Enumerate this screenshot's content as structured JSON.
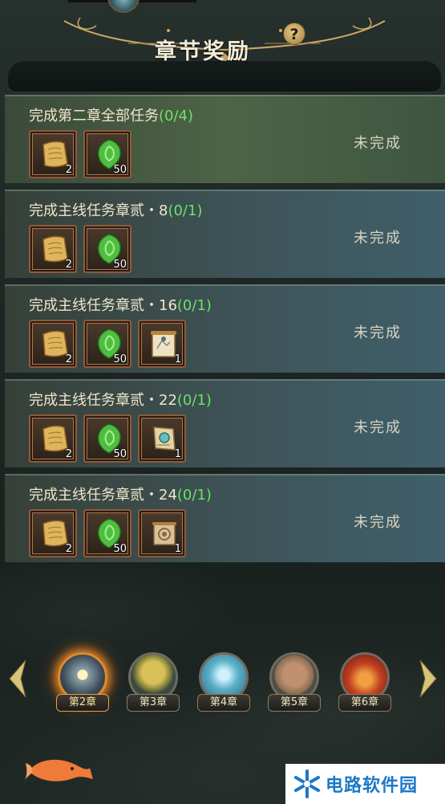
{
  "header": {
    "title": "章节奖励",
    "help_symbol": "?"
  },
  "tasks": [
    {
      "title": "完成第二章全部任务",
      "progress": "(0/4)",
      "status": "未完成",
      "rewards": [
        {
          "icon": "scroll-paper-icon",
          "count": "2"
        },
        {
          "icon": "jade-leaf-icon",
          "count": "50"
        }
      ]
    },
    {
      "title": "完成主线任务章贰・8",
      "progress": "(0/1)",
      "status": "未完成",
      "rewards": [
        {
          "icon": "scroll-paper-icon",
          "count": "2"
        },
        {
          "icon": "jade-leaf-icon",
          "count": "50"
        }
      ]
    },
    {
      "title": "完成主线任务章贰・16",
      "progress": "(0/1)",
      "status": "未完成",
      "rewards": [
        {
          "icon": "scroll-paper-icon",
          "count": "2"
        },
        {
          "icon": "jade-leaf-icon",
          "count": "50"
        },
        {
          "icon": "scroll-map-icon",
          "count": "1"
        }
      ]
    },
    {
      "title": "完成主线任务章贰・22",
      "progress": "(0/1)",
      "status": "未完成",
      "rewards": [
        {
          "icon": "scroll-paper-icon",
          "count": "2"
        },
        {
          "icon": "jade-leaf-icon",
          "count": "50"
        },
        {
          "icon": "scroll-gem-icon",
          "count": "1"
        }
      ]
    },
    {
      "title": "完成主线任务章贰・24",
      "progress": "(0/1)",
      "status": "未完成",
      "rewards": [
        {
          "icon": "scroll-paper-icon",
          "count": "2"
        },
        {
          "icon": "jade-leaf-icon",
          "count": "50"
        },
        {
          "icon": "scroll-roll-icon",
          "count": "1"
        }
      ]
    }
  ],
  "chapters": [
    {
      "label": "第2章",
      "active": true,
      "theme": "sunset-sea"
    },
    {
      "label": "第3章",
      "active": false,
      "theme": "golden-tree"
    },
    {
      "label": "第4章",
      "active": false,
      "theme": "ice-crystal"
    },
    {
      "label": "第5章",
      "active": false,
      "theme": "stone-giant"
    },
    {
      "label": "第6章",
      "active": false,
      "theme": "red-lava"
    }
  ],
  "watermark": {
    "text": "电路软件园"
  },
  "colors": {
    "progress": "#6ee06a",
    "accent_orange": "#e08a2a",
    "title_cream": "#f4ecd5"
  }
}
